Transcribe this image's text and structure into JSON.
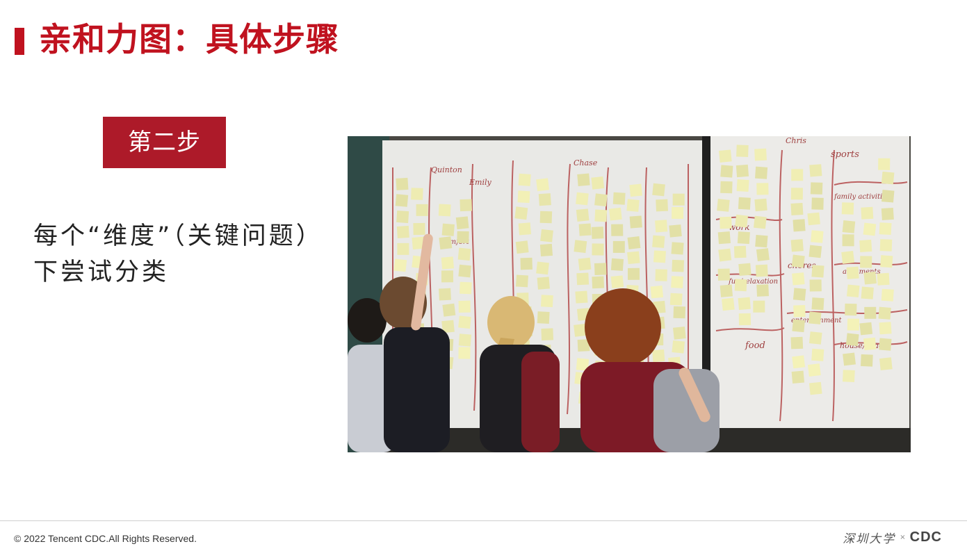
{
  "slide": {
    "title": "亲和力图：具体步骤",
    "step_label": "第二步",
    "body_text": "每个“维度”（关键问题）下尝试分类",
    "accent_color": "#c0121f",
    "badge_color": "#ad1a29"
  },
  "photo": {
    "labels": {
      "quinton": "Quinton",
      "emily": "Emily",
      "chase": "Chase",
      "chris": "Chris",
      "sports": "sports",
      "family": "family activities",
      "work": "work",
      "chores": "chores",
      "arguments": "arguments",
      "fun": "fun/relaxation",
      "entertainment": "entertainment",
      "food": "food",
      "house": "house/space",
      "comfort": "comfort"
    }
  },
  "footer": {
    "copyright": "© 2022 Tencent CDC.All Rights Reserved.",
    "logo_university": "深圳大学",
    "logo_separator": "×",
    "logo_brand": "CDC"
  }
}
